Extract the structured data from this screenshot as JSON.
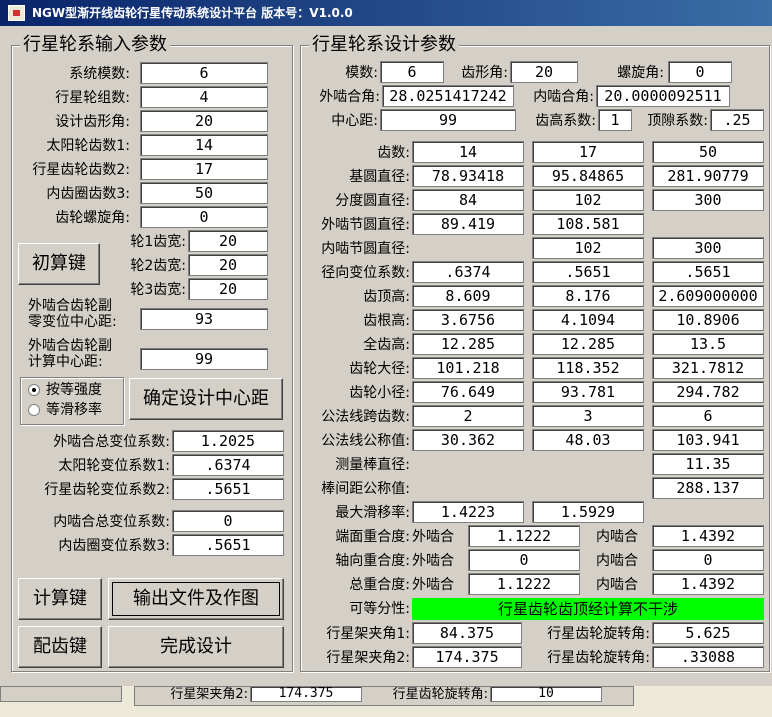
{
  "window": {
    "title": "NGW型渐开线齿轮行星传动系统设计平台   版本号：V1.0.0"
  },
  "input_group": {
    "title": "行星轮系输入参数",
    "fields": [
      {
        "label": "系统模数:",
        "value": "6"
      },
      {
        "label": "行星轮组数:",
        "value": "4"
      },
      {
        "label": "设计齿形角:",
        "value": "20"
      },
      {
        "label": "太阳轮齿数1:",
        "value": "14"
      },
      {
        "label": "行星齿轮齿数2:",
        "value": "17"
      },
      {
        "label": "内齿圈齿数3:",
        "value": "50"
      },
      {
        "label": "齿轮螺旋角:",
        "value": "0"
      }
    ],
    "widths": [
      {
        "label": "轮1齿宽:",
        "value": "20"
      },
      {
        "label": "轮2齿宽:",
        "value": "20"
      },
      {
        "label": "轮3齿宽:",
        "value": "20"
      }
    ],
    "initial_button": "初算键",
    "zero_shift_label_1": "外啮合齿轮副",
    "zero_shift_label_2": "零变位中心距:",
    "zero_shift_value": "93",
    "calc_center_label_1": "外啮合齿轮副",
    "calc_center_label_2": "计算中心距:",
    "calc_center_value": "99",
    "radio_strength": "按等强度",
    "radio_slip": "等滑移率",
    "confirm_center_button": "确定设计中心距",
    "shift": [
      {
        "label": "外啮合总变位系数:",
        "value": "1.2025"
      },
      {
        "label": "太阳轮变位系数1:",
        "value": ".6374"
      },
      {
        "label": "行星齿轮变位系数2:",
        "value": ".5651"
      },
      {
        "label": "内啮合总变位系数:",
        "value": "0"
      },
      {
        "label": "内齿圈变位系数3:",
        "value": ".5651"
      }
    ],
    "calc_button": "计算键",
    "output_button": "输出文件及作图",
    "match_button": "配齿键",
    "finish_button": "完成设计"
  },
  "design_group": {
    "title": "行星轮系设计参数",
    "module_label": "模数:",
    "module_value": "6",
    "tooth_angle_label": "齿形角:",
    "tooth_angle_value": "20",
    "helix_label": "螺旋角:",
    "helix_value": "0",
    "ext_angle_label": "外啮合角:",
    "ext_angle_value": "28.0251417242",
    "int_angle_label": "内啮合角:",
    "int_angle_value": "20.0000092511",
    "center_label": "中心距:",
    "center_value": "99",
    "addendum_coef_label": "齿高系数:",
    "addendum_coef_value": "1",
    "clearance_label": "顶隙系数:",
    "clearance_value": ".25",
    "rows": [
      {
        "label": "齿数:",
        "c1": "14",
        "c2": "17",
        "c3": "50"
      },
      {
        "label": "基圆直径:",
        "c1": "78.93418",
        "c2": "95.84865",
        "c3": "281.90779"
      },
      {
        "label": "分度圆直径:",
        "c1": "84",
        "c2": "102",
        "c3": "300"
      },
      {
        "label": "外啮节圆直径:",
        "c1": "89.419",
        "c2": "108.581",
        "c3": ""
      },
      {
        "label": "内啮节圆直径:",
        "c1": "",
        "c2": "102",
        "c3": "300"
      },
      {
        "label": "径向变位系数:",
        "c1": ".6374",
        "c2": ".5651",
        "c3": ".5651"
      },
      {
        "label": "齿顶高:",
        "c1": "8.609",
        "c2": "8.176",
        "c3": "2.609000000"
      },
      {
        "label": "齿根高:",
        "c1": "3.6756",
        "c2": "4.1094",
        "c3": "10.8906"
      },
      {
        "label": "全齿高:",
        "c1": "12.285",
        "c2": "12.285",
        "c3": "13.5"
      },
      {
        "label": "齿轮大径:",
        "c1": "101.218",
        "c2": "118.352",
        "c3": "321.7812"
      },
      {
        "label": "齿轮小径:",
        "c1": "76.649",
        "c2": "93.781",
        "c3": "294.782"
      },
      {
        "label": "公法线跨齿数:",
        "c1": "2",
        "c2": "3",
        "c3": "6"
      },
      {
        "label": "公法线公称值:",
        "c1": "30.362",
        "c2": "48.03",
        "c3": "103.941"
      },
      {
        "label": "测量棒直径:",
        "c1": "",
        "c2": "",
        "c3": "11.35"
      },
      {
        "label": "棒间距公称值:",
        "c1": "",
        "c2": "",
        "c3": "288.137"
      },
      {
        "label": "最大滑移率:",
        "c1": "1.4223",
        "c2": "1.5929",
        "c3": ""
      }
    ],
    "overlap": [
      {
        "label": "端面重合度:",
        "ext_label": "外啮合",
        "ext_value": "1.1222",
        "int_label": "内啮合",
        "int_value": "1.4392"
      },
      {
        "label": "轴向重合度:",
        "ext_label": "外啮合",
        "ext_value": "0",
        "int_label": "内啮合",
        "int_value": "0"
      },
      {
        "label": "总重合度:",
        "ext_label": "外啮合",
        "ext_value": "1.1222",
        "int_label": "内啮合",
        "int_value": "1.4392"
      }
    ],
    "assembly_label": "可等分性:",
    "assembly_status": "行星齿轮齿顶经计算不干涉",
    "carrier1_label": "行星架夹角1:",
    "carrier1_value": "84.375",
    "rot1_label": "行星齿轮旋转角:",
    "rot1_value": "5.625",
    "carrier2_label": "行星架夹角2:",
    "carrier2_value": "174.375",
    "rot2_label": "行星齿轮旋转角:",
    "rot2_value": ".33088"
  },
  "behind_window": {
    "carrier2_label": "行星架夹角2:",
    "carrier2_value": "174.375",
    "rot_label": "行星齿轮旋转角:",
    "rot_value": "10"
  }
}
